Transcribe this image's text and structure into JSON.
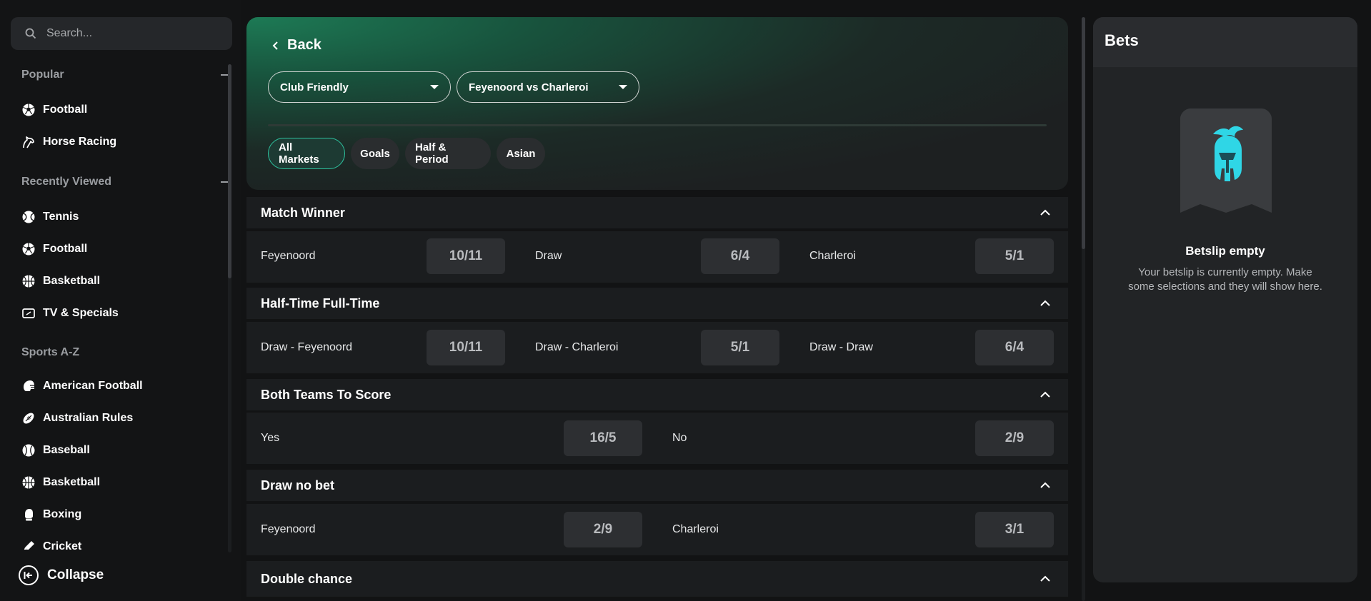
{
  "search": {
    "placeholder": "Search..."
  },
  "sidebar": {
    "popular_title": "Popular",
    "popular": [
      {
        "label": "Football",
        "icon": "football-icon"
      },
      {
        "label": "Horse Racing",
        "icon": "horse-racing-icon"
      }
    ],
    "recent_title": "Recently Viewed",
    "recent": [
      {
        "label": "Tennis",
        "icon": "tennis-icon"
      },
      {
        "label": "Football",
        "icon": "football-icon"
      },
      {
        "label": "Basketball",
        "icon": "basketball-icon"
      },
      {
        "label": "TV & Specials",
        "icon": "tv-icon"
      }
    ],
    "az_title": "Sports A-Z",
    "az": [
      {
        "label": "American Football",
        "icon": "american-football-icon"
      },
      {
        "label": "Australian Rules",
        "icon": "australian-rules-icon"
      },
      {
        "label": "Baseball",
        "icon": "baseball-icon"
      },
      {
        "label": "Basketball",
        "icon": "basketball-icon"
      },
      {
        "label": "Boxing",
        "icon": "boxing-icon"
      },
      {
        "label": "Cricket",
        "icon": "cricket-icon"
      }
    ],
    "collapse_label": "Collapse"
  },
  "header": {
    "back_label": "Back",
    "competition": "Club Friendly",
    "match": "Feyenoord vs Charleroi"
  },
  "tabs": [
    "All Markets",
    "Goals",
    "Half & Period",
    "Asian"
  ],
  "active_tab": "All Markets",
  "markets": {
    "match_winner": {
      "title": "Match Winner",
      "selections": [
        {
          "label": "Feyenoord",
          "odds": "10/11"
        },
        {
          "label": "Draw",
          "odds": "6/4"
        },
        {
          "label": "Charleroi",
          "odds": "5/1"
        }
      ]
    },
    "htft": {
      "title": "Half-Time Full-Time",
      "selections": [
        {
          "label": "Draw - Feyenoord",
          "odds": "10/11"
        },
        {
          "label": "Draw - Charleroi",
          "odds": "5/1"
        },
        {
          "label": "Draw - Draw",
          "odds": "6/4"
        }
      ]
    },
    "btts": {
      "title": "Both Teams To Score",
      "selections": [
        {
          "label": "Yes",
          "odds": "16/5"
        },
        {
          "label": "No",
          "odds": "2/9"
        }
      ]
    },
    "dnb": {
      "title": "Draw no bet",
      "selections": [
        {
          "label": "Feyenoord",
          "odds": "2/9"
        },
        {
          "label": "Charleroi",
          "odds": "3/1"
        }
      ]
    },
    "double_chance": {
      "title": "Double chance"
    }
  },
  "betslip": {
    "title": "Bets",
    "empty_title": "Betslip empty",
    "empty_message": "Your betslip is currently empty. Make some selections and they will show here."
  },
  "colors": {
    "accent": "#2ec4a0",
    "background": "#121314",
    "panel": "#1b1d1f",
    "odds_button": "#2d2f32"
  }
}
